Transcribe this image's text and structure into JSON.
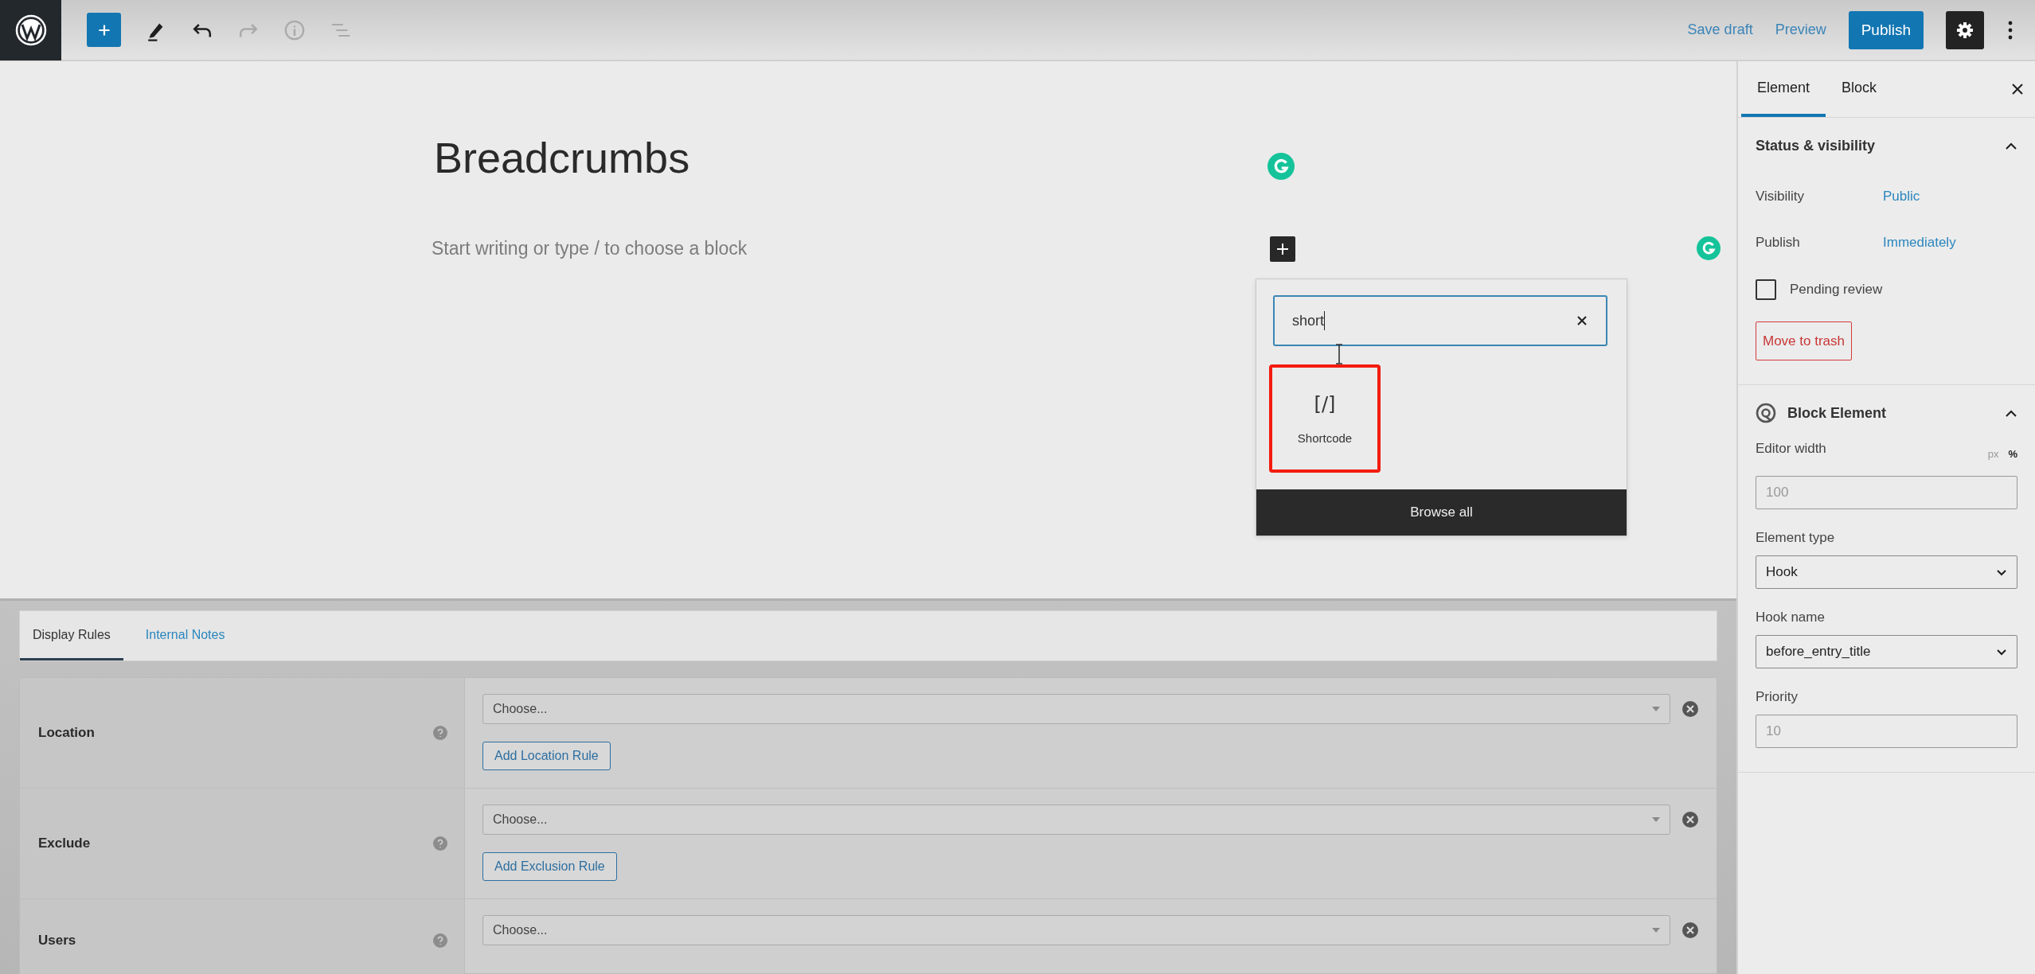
{
  "header": {
    "tools": [
      {
        "kind": "add",
        "disabled": false
      },
      {
        "kind": "edit",
        "disabled": false
      },
      {
        "kind": "undo",
        "disabled": false
      },
      {
        "kind": "redo",
        "disabled": true
      },
      {
        "kind": "info",
        "disabled": true
      },
      {
        "kind": "outline",
        "disabled": true
      }
    ],
    "save_draft": "Save draft",
    "preview": "Preview",
    "publish": "Publish",
    "settings_active": true
  },
  "editor": {
    "title": "Breadcrumbs",
    "placeholder": "Start writing or type / to choose a block"
  },
  "inserter": {
    "search_value": "short",
    "results": [
      {
        "icon_text": "[/]",
        "label": "Shortcode",
        "highlighted": true
      }
    ],
    "browse_all": "Browse all"
  },
  "metabox": {
    "tabs": [
      {
        "label": "Display Rules",
        "selected": true
      },
      {
        "label": "Internal Notes",
        "selected": false
      }
    ],
    "rules": [
      {
        "label": "Location",
        "select": "Choose...",
        "button": "Add Location Rule"
      },
      {
        "label": "Exclude",
        "select": "Choose...",
        "button": "Add Exclusion Rule"
      },
      {
        "label": "Users",
        "select": "Choose..."
      }
    ]
  },
  "sidebar": {
    "tabs": [
      {
        "label": "Element",
        "selected": true
      },
      {
        "label": "Block",
        "selected": false
      }
    ],
    "status_panel": {
      "title": "Status & visibility",
      "expanded": true,
      "rows": [
        {
          "label": "Visibility",
          "value": "Public"
        },
        {
          "label": "Publish",
          "value": "Immediately"
        }
      ],
      "pending_review": {
        "label": "Pending review",
        "checked": false
      },
      "trash": "Move to trash"
    },
    "block_panel": {
      "title": "Block Element",
      "expanded": true,
      "editor_width": {
        "label": "Editor width",
        "units": [
          {
            "label": "px",
            "selected": false
          },
          {
            "label": "%",
            "selected": true
          }
        ],
        "placeholder": "100"
      },
      "element_type": {
        "label": "Element type",
        "value": "Hook"
      },
      "hook_name": {
        "label": "Hook name",
        "value": "before_entry_title"
      },
      "priority": {
        "label": "Priority",
        "placeholder": "10"
      }
    }
  }
}
